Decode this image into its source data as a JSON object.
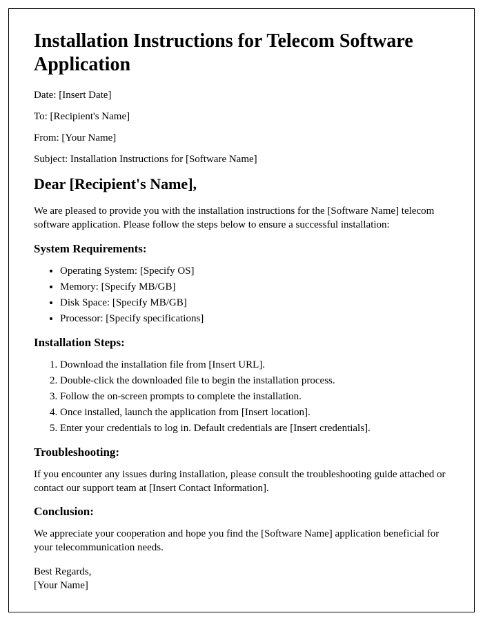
{
  "title": "Installation Instructions for Telecom Software Application",
  "meta": {
    "date": "Date: [Insert Date]",
    "to": "To: [Recipient's Name]",
    "from": "From: [Your Name]",
    "subject": "Subject: Installation Instructions for [Software Name]"
  },
  "salutation": "Dear [Recipient's Name],",
  "intro": "We are pleased to provide you with the installation instructions for the [Software Name] telecom software application. Please follow the steps below to ensure a successful installation:",
  "sections": {
    "sysreq": {
      "heading": "System Requirements:",
      "items": [
        "Operating System: [Specify OS]",
        "Memory: [Specify MB/GB]",
        "Disk Space: [Specify MB/GB]",
        "Processor: [Specify specifications]"
      ]
    },
    "steps": {
      "heading": "Installation Steps:",
      "items": [
        "Download the installation file from [Insert URL].",
        "Double-click the downloaded file to begin the installation process.",
        "Follow the on-screen prompts to complete the installation.",
        "Once installed, launch the application from [Insert location].",
        "Enter your credentials to log in. Default credentials are [Insert credentials]."
      ]
    },
    "troubleshooting": {
      "heading": "Troubleshooting:",
      "text": "If you encounter any issues during installation, please consult the troubleshooting guide attached or contact our support team at [Insert Contact Information]."
    },
    "conclusion": {
      "heading": "Conclusion:",
      "text": "We appreciate your cooperation and hope you find the [Software Name] application beneficial for your telecommunication needs."
    }
  },
  "signoff": {
    "regards": "Best Regards,",
    "name": "[Your Name]"
  }
}
